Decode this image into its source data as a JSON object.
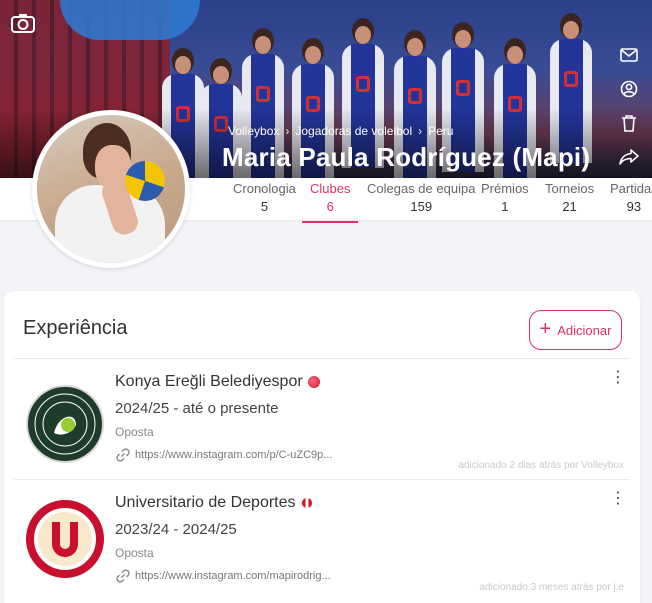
{
  "header": {
    "breadcrumb": [
      "Volleybox",
      "Jogadoras de voleibol",
      "Peru"
    ],
    "title": "Maria Paula Rodríguez (Mapi)"
  },
  "tabs": [
    {
      "label": "Cronologia",
      "count": "5",
      "active": false
    },
    {
      "label": "Clubes",
      "count": "6",
      "active": true
    },
    {
      "label": "Colegas de equipa",
      "count": "159",
      "active": false
    },
    {
      "label": "Prémios",
      "count": "1",
      "active": false
    },
    {
      "label": "Torneios",
      "count": "21",
      "active": false
    },
    {
      "label": "Partidas",
      "count": "93",
      "active": false
    }
  ],
  "experience": {
    "title": "Experiência",
    "add_label": "Adicionar",
    "entries": [
      {
        "club": "Konya Ereğli Belediyespor",
        "flag_color": "#d9253a",
        "period": "2024/25 - até o presente",
        "role": "Oposta",
        "link": "https://www.instagram.com/p/C-uZC9p...",
        "added": "adicionado 2 dias atrás por Volleybox"
      },
      {
        "club": "Universitario de Deportes",
        "flag_color": "#d9253a",
        "period": "2023/24 - 2024/25",
        "role": "Oposta",
        "link": "https://www.instagram.com/mapirodrig...",
        "added": "adicionado 3 meses atrás por j.e"
      }
    ]
  },
  "colors": {
    "accent": "#e0305f",
    "page_bg": "#f3f4f8"
  },
  "icons": [
    "camera-icon",
    "mail-icon",
    "user-circle-icon",
    "trash-icon",
    "share-icon",
    "plus-icon",
    "link-icon",
    "more-vertical-icon"
  ]
}
